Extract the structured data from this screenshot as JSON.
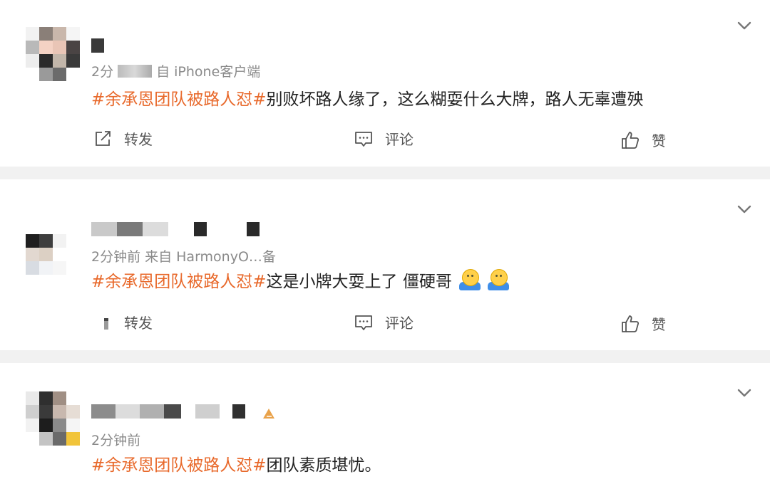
{
  "posts": [
    {
      "meta_time": "2分",
      "meta_source": "自 iPhone客户端",
      "topic": "#余承恩团队被路人怼#",
      "text": "别败坏路人缘了，这么糊耍什么大牌，路人无辜遭殃",
      "emoji_count": 0,
      "actions": {
        "repost": "转发",
        "comment": "评论",
        "like": "赞"
      }
    },
    {
      "meta_time": "2分钟前",
      "meta_source": "来自 HarmonyO…备",
      "topic": "#余承恩团队被路人怼#",
      "text": "这是小牌大耍上了 僵硬哥",
      "emoji_count": 2,
      "actions": {
        "repost": "转发",
        "comment": "评论",
        "like": "赞"
      }
    },
    {
      "meta_time": "2分钟前",
      "meta_source": "",
      "topic": "#余承恩团队被路人怼#",
      "text": "团队素质堪忧。",
      "emoji_count": 0
    }
  ],
  "icons": {
    "chevron": "chevron-down-icon",
    "repost": "share-icon",
    "comment": "comment-icon",
    "like": "thumbs-up-icon",
    "emoji": "shrug-emoji-icon"
  },
  "colors": {
    "topic": "#e8692b",
    "separator": "#f1f1f1",
    "meta": "#8a8a8a"
  }
}
